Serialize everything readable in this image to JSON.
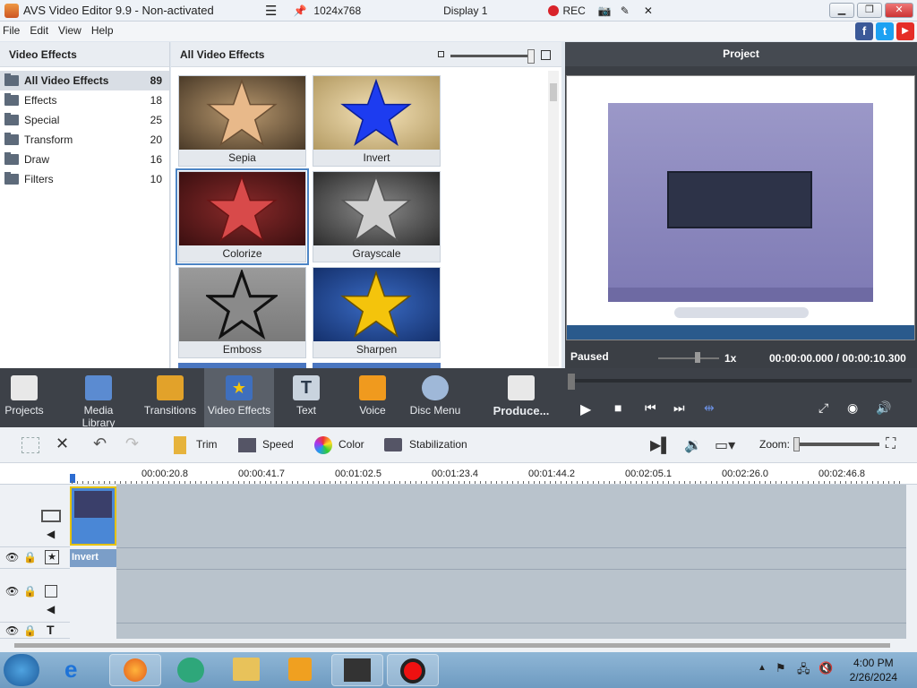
{
  "window": {
    "title": "AVS Video Editor 9.9 - Non-activated"
  },
  "capture_bar": {
    "resolution": "1024x768",
    "display": "Display 1",
    "rec": "REC"
  },
  "menu": [
    "File",
    "Edit",
    "View",
    "Help"
  ],
  "left_panel": {
    "title": "Video Effects",
    "categories": [
      {
        "label": "All Video Effects",
        "count": "89"
      },
      {
        "label": "Effects",
        "count": "18"
      },
      {
        "label": "Special",
        "count": "25"
      },
      {
        "label": "Transform",
        "count": "20"
      },
      {
        "label": "Draw",
        "count": "16"
      },
      {
        "label": "Filters",
        "count": "10"
      }
    ]
  },
  "gallery": {
    "title": "All Video Effects",
    "effects": [
      "Sepia",
      "Invert",
      "Colorize",
      "Grayscale",
      "Emboss",
      "Sharpen"
    ]
  },
  "project": {
    "title": "Project",
    "status": "Paused",
    "speed": "1x",
    "time_current": "00:00:00.000",
    "time_separator": "/",
    "time_total": "00:00:10.300"
  },
  "toolbar": [
    "Projects",
    "Media Library",
    "Transitions",
    "Video Effects",
    "Text",
    "Voice",
    "Disc Menu",
    "Produce..."
  ],
  "edit_bar": {
    "trim": "Trim",
    "speed": "Speed",
    "color": "Color",
    "stabilization": "Stabilization",
    "zoom": "Zoom:"
  },
  "ruler_ticks": [
    "00:00:20.8",
    "00:00:41.7",
    "00:01:02.5",
    "00:01:23.4",
    "00:01:44.2",
    "00:02:05.1",
    "00:02:26.0",
    "00:02:46.8"
  ],
  "effect_clip_label": "Invert",
  "clock": {
    "time": "4:00 PM",
    "date": "2/26/2024"
  }
}
